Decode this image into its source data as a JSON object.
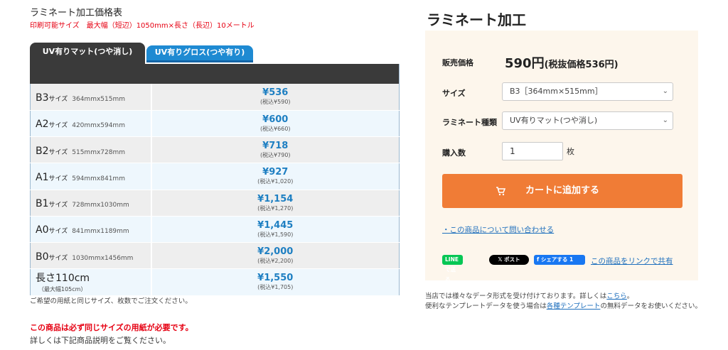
{
  "left": {
    "title": "ラミネート加工価格表",
    "print_size": "印刷可能サイズ　最大幅（短辺）1050mm×長さ（長辺）10メートル",
    "tabs": [
      {
        "label": "UV有りマット(つや消し)",
        "active": true
      },
      {
        "label": "UV有りグロス(つや有り)",
        "active": false
      }
    ],
    "rows": [
      {
        "name": "B3",
        "word": "サイズ",
        "dim": "364mmx515mm",
        "price": "¥536",
        "tax": "(税込¥590)"
      },
      {
        "name": "A2",
        "word": "サイズ",
        "dim": "420mmx594mm",
        "price": "¥600",
        "tax": "(税込¥660)"
      },
      {
        "name": "B2",
        "word": "サイズ",
        "dim": "515mmx728mm",
        "price": "¥718",
        "tax": "(税込¥790)"
      },
      {
        "name": "A1",
        "word": "サイズ",
        "dim": "594mmx841mm",
        "price": "¥927",
        "tax": "(税込¥1,020)"
      },
      {
        "name": "B1",
        "word": "サイズ",
        "dim": "728mmx1030mm",
        "price": "¥1,154",
        "tax": "(税込¥1,270)"
      },
      {
        "name": "A0",
        "word": "サイズ",
        "dim": "841mmx1189mm",
        "price": "¥1,445",
        "tax": "(税込¥1,590)"
      },
      {
        "name": "B0",
        "word": "サイズ",
        "dim": "1030mmx1456mm",
        "price": "¥2,000",
        "tax": "(税込¥2,200)"
      },
      {
        "name": "長さ110cm",
        "sub": "（最大幅105cm）",
        "price": "¥1,550",
        "tax": "(税込¥1,705)"
      }
    ],
    "note": "ご希望の用紙と同じサイズ、枚数でご注文ください。",
    "warning": "この商品は必ず同じサイズの用紙が必要です。",
    "detail": "詳しくは下記商品説明をご覧ください。"
  },
  "right": {
    "title": "ラミネート加工",
    "sale_label": "販売価格",
    "sale_price": "590円",
    "sale_tax_in": "(税抜価格536円)",
    "size_label": "サイズ",
    "size_value": "B3［364mm×515mm］",
    "type_label": "ラミネート種類",
    "type_value": "UV有りマット(つや消し)",
    "qty_label": "購入数",
    "qty_value": "1",
    "qty_unit": "枚",
    "cart_label": "カートに追加する",
    "inquiry": "・この商品について問い合わせる",
    "share_line": "LINEで送る",
    "share_x": "ポスト",
    "share_fb": "シェアする 1",
    "share_link": "この商品をリンクで共有",
    "info_1": "当店では様々なデータ形式を受け付けております。詳しくは",
    "info_link_1": "こちら",
    "info_2": "便利なテンプレートデータを使う場合は",
    "info_link_2": "各種テンプレート",
    "info_3": "の無料データをお使いください。"
  },
  "colors": {
    "accent_orange": "#f07c36",
    "price_blue": "#1e7fc2",
    "warning_red": "#e60012",
    "panel_bg": "#fdf6ec",
    "tab_dark": "#3a3a3a",
    "tab_blue": "#1e8ad2"
  },
  "icons": [
    "cart-icon",
    "chevron-down-icon",
    "line-icon",
    "x-icon",
    "facebook-icon"
  ]
}
